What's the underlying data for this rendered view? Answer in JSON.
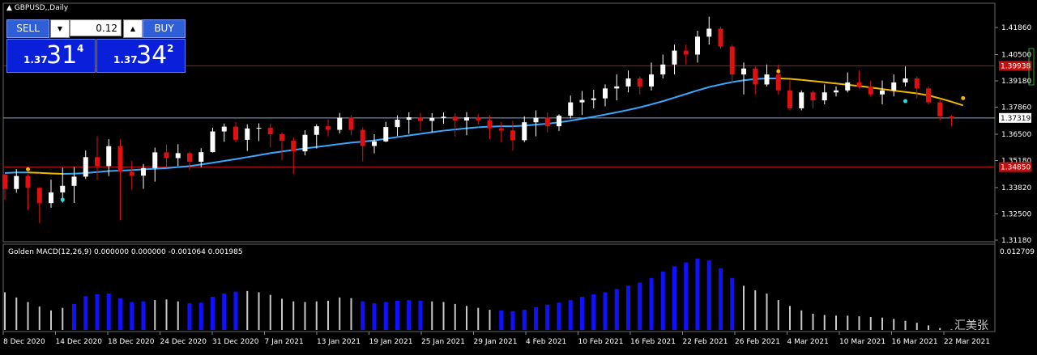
{
  "window": {
    "title": "▲ GBPUSD,,Daily"
  },
  "trade_panel": {
    "sell_label": "SELL",
    "buy_label": "BUY",
    "lot_value": "0.12",
    "down_arrow": "▼",
    "up_arrow": "▲",
    "bid": {
      "prefix": "1.37",
      "big": "31",
      "sup": "4"
    },
    "ask": {
      "prefix": "1.37",
      "big": "34",
      "sup": "2"
    }
  },
  "price_axis": {
    "ticks": [
      "1.41860",
      "1.40500",
      "1.39180",
      "1.37860",
      "1.36500",
      "1.35180",
      "1.33820",
      "1.32500",
      "1.31180"
    ],
    "labels": [
      {
        "text": "1.39938",
        "value": 1.39938,
        "color": "#d01010"
      },
      {
        "text": "1.37319",
        "value": 1.37319,
        "color": "#ffffff"
      },
      {
        "text": "1.34850",
        "value": 1.3485,
        "color": "#d01010"
      }
    ]
  },
  "indicator": {
    "label": "Golden MACD(12,26,9) 0.000000 0.000000 -0.001064 0.001985",
    "max_label": "0.012709"
  },
  "date_axis": [
    "8 Dec 2020",
    "14 Dec 2020",
    "18 Dec 2020",
    "24 Dec 2020",
    "31 Dec 2020",
    "7 Jan 2021",
    "13 Jan 2021",
    "19 Jan 2021",
    "25 Jan 2021",
    "29 Jan 2021",
    "4 Feb 2021",
    "10 Feb 2021",
    "16 Feb 2021",
    "22 Feb 2021",
    "26 Feb 2021",
    "4 Mar 2021",
    "10 Mar 2021",
    "16 Mar 2021",
    "22 Mar 2021"
  ],
  "watermark": "汇美张",
  "colors": {
    "bull": "#ffffff",
    "bear": "#e01010",
    "ma_up": "#39a8ff",
    "ma_down": "#f0b800",
    "macd_pos": "#1010ff",
    "macd_other": "#c8c8c8",
    "hline": "#c01010",
    "cur_line": "#7fa9d8"
  },
  "chart_data": {
    "type": "candlestick",
    "symbol": "GBPUSD",
    "timeframe": "Daily",
    "ylim": [
      1.3118,
      1.4186
    ],
    "candles": [
      [
        1.3448,
        1.345,
        1.332,
        1.3375
      ],
      [
        1.3375,
        1.3475,
        1.3356,
        1.344
      ],
      [
        1.344,
        1.345,
        1.327,
        1.3381
      ],
      [
        1.3381,
        1.3384,
        1.3204,
        1.3304
      ],
      [
        1.3304,
        1.3422,
        1.3281,
        1.3358
      ],
      [
        1.3358,
        1.3482,
        1.3307,
        1.3391
      ],
      [
        1.3391,
        1.3486,
        1.3305,
        1.3437
      ],
      [
        1.3437,
        1.3568,
        1.3425,
        1.3535
      ],
      [
        1.3535,
        1.364,
        1.342,
        1.349
      ],
      [
        1.349,
        1.3625,
        1.344,
        1.359
      ],
      [
        1.359,
        1.3624,
        1.3218,
        1.3461
      ],
      [
        1.3461,
        1.3517,
        1.3372,
        1.3442
      ],
      [
        1.3442,
        1.35,
        1.3376,
        1.348
      ],
      [
        1.348,
        1.3583,
        1.3412,
        1.3559
      ],
      [
        1.3559,
        1.3598,
        1.3482,
        1.353
      ],
      [
        1.353,
        1.36,
        1.349,
        1.3555
      ],
      [
        1.3555,
        1.3563,
        1.347,
        1.3512
      ],
      [
        1.3512,
        1.358,
        1.3484,
        1.356
      ],
      [
        1.356,
        1.3683,
        1.3558,
        1.3664
      ],
      [
        1.3664,
        1.3704,
        1.3612,
        1.3688
      ],
      [
        1.3688,
        1.3711,
        1.3609,
        1.3622
      ],
      [
        1.3622,
        1.37,
        1.3566,
        1.3679
      ],
      [
        1.3679,
        1.3705,
        1.3616,
        1.3682
      ],
      [
        1.3682,
        1.3703,
        1.3584,
        1.365
      ],
      [
        1.365,
        1.366,
        1.352,
        1.3617
      ],
      [
        1.3617,
        1.3635,
        1.345,
        1.3564
      ],
      [
        1.3564,
        1.367,
        1.3544,
        1.3647
      ],
      [
        1.3647,
        1.37,
        1.3578,
        1.369
      ],
      [
        1.369,
        1.3725,
        1.364,
        1.3672
      ],
      [
        1.3672,
        1.3757,
        1.3654,
        1.3733
      ],
      [
        1.3733,
        1.3745,
        1.3646,
        1.3672
      ],
      [
        1.3672,
        1.3685,
        1.3514,
        1.3591
      ],
      [
        1.3591,
        1.365,
        1.3554,
        1.3614
      ],
      [
        1.3614,
        1.3712,
        1.361,
        1.3686
      ],
      [
        1.3686,
        1.3745,
        1.3641,
        1.3723
      ],
      [
        1.3723,
        1.376,
        1.3652,
        1.3735
      ],
      [
        1.3735,
        1.3757,
        1.3665,
        1.3717
      ],
      [
        1.3717,
        1.3756,
        1.3659,
        1.3732
      ],
      [
        1.3732,
        1.3759,
        1.3702,
        1.3738
      ],
      [
        1.3738,
        1.3755,
        1.3639,
        1.3719
      ],
      [
        1.3719,
        1.3761,
        1.3645,
        1.3735
      ],
      [
        1.3735,
        1.3752,
        1.3699,
        1.372
      ],
      [
        1.372,
        1.3745,
        1.3625,
        1.368
      ],
      [
        1.368,
        1.3711,
        1.361,
        1.3669
      ],
      [
        1.3669,
        1.3717,
        1.3567,
        1.362
      ],
      [
        1.362,
        1.374,
        1.361,
        1.371
      ],
      [
        1.371,
        1.377,
        1.364,
        1.3733
      ],
      [
        1.3733,
        1.376,
        1.3659,
        1.369
      ],
      [
        1.369,
        1.375,
        1.3667,
        1.3743
      ],
      [
        1.3743,
        1.3844,
        1.3729,
        1.381
      ],
      [
        1.381,
        1.3867,
        1.3747,
        1.3822
      ],
      [
        1.3822,
        1.3873,
        1.378,
        1.383
      ],
      [
        1.383,
        1.39,
        1.379,
        1.388
      ],
      [
        1.388,
        1.395,
        1.382,
        1.389
      ],
      [
        1.389,
        1.397,
        1.386,
        1.393
      ],
      [
        1.393,
        1.394,
        1.385,
        1.389
      ],
      [
        1.389,
        1.401,
        1.387,
        1.395
      ],
      [
        1.395,
        1.405,
        1.393,
        1.4
      ],
      [
        1.4,
        1.41,
        1.395,
        1.407
      ],
      [
        1.407,
        1.41,
        1.4,
        1.405
      ],
      [
        1.405,
        1.417,
        1.401,
        1.414
      ],
      [
        1.414,
        1.424,
        1.41,
        1.418
      ],
      [
        1.418,
        1.419,
        1.408,
        1.409
      ],
      [
        1.409,
        1.41,
        1.391,
        1.395
      ],
      [
        1.395,
        1.401,
        1.385,
        1.398
      ],
      [
        1.398,
        1.399,
        1.385,
        1.39
      ],
      [
        1.39,
        1.4,
        1.389,
        1.395
      ],
      [
        1.395,
        1.4,
        1.385,
        1.387
      ],
      [
        1.387,
        1.392,
        1.377,
        1.378
      ],
      [
        1.378,
        1.387,
        1.377,
        1.386
      ],
      [
        1.386,
        1.387,
        1.378,
        1.382
      ],
      [
        1.382,
        1.39,
        1.38,
        1.386
      ],
      [
        1.386,
        1.389,
        1.384,
        1.387
      ],
      [
        1.387,
        1.396,
        1.386,
        1.391
      ],
      [
        1.391,
        1.397,
        1.388,
        1.389
      ],
      [
        1.389,
        1.392,
        1.384,
        1.385
      ],
      [
        1.385,
        1.392,
        1.38,
        1.387
      ],
      [
        1.387,
        1.395,
        1.384,
        1.391
      ],
      [
        1.391,
        1.399,
        1.389,
        1.393
      ],
      [
        1.393,
        1.394,
        1.383,
        1.388
      ],
      [
        1.388,
        1.389,
        1.38,
        1.381
      ],
      [
        1.381,
        1.382,
        1.372,
        1.374
      ],
      [
        1.374,
        1.3745,
        1.369,
        1.3731
      ]
    ],
    "moving_average": [
      1.3455,
      1.3458,
      1.3458,
      1.3456,
      1.3453,
      1.3451,
      1.3452,
      1.3455,
      1.346,
      1.3465,
      1.3467,
      1.347,
      1.3474,
      1.3477,
      1.348,
      1.3485,
      1.349,
      1.3498,
      1.3507,
      1.3516,
      1.3525,
      1.3535,
      1.3545,
      1.3555,
      1.3563,
      1.3571,
      1.3579,
      1.3586,
      1.3593,
      1.3601,
      1.3608,
      1.3613,
      1.3619,
      1.3627,
      1.3636,
      1.3644,
      1.3652,
      1.366,
      1.3668,
      1.3674,
      1.368,
      1.3685,
      1.3688,
      1.369,
      1.369,
      1.3693,
      1.3698,
      1.3703,
      1.371,
      1.3718,
      1.3728,
      1.3738,
      1.3749,
      1.376,
      1.3772,
      1.3785,
      1.38,
      1.3816,
      1.3834,
      1.3852,
      1.387,
      1.3887,
      1.39,
      1.3912,
      1.3921,
      1.3927,
      1.393,
      1.393,
      1.3928,
      1.3923,
      1.3917,
      1.3911,
      1.3905,
      1.3898,
      1.3892,
      1.3885,
      1.3877,
      1.3869,
      1.3862,
      1.3855,
      1.3845,
      1.383,
      1.3813,
      1.3795
    ],
    "macd_histogram": [
      0.0058,
      0.005,
      0.0043,
      0.0036,
      0.003,
      0.0034,
      0.004,
      0.0052,
      0.0055,
      0.0056,
      0.0049,
      0.0043,
      0.0044,
      0.0046,
      0.0047,
      0.0044,
      0.0041,
      0.0042,
      0.0051,
      0.0056,
      0.0059,
      0.006,
      0.0058,
      0.0054,
      0.0048,
      0.0044,
      0.0043,
      0.0044,
      0.0045,
      0.005,
      0.0049,
      0.0044,
      0.0041,
      0.0043,
      0.0045,
      0.0046,
      0.0045,
      0.0044,
      0.0043,
      0.004,
      0.0037,
      0.0034,
      0.0031,
      0.003,
      0.0029,
      0.0031,
      0.0035,
      0.0039,
      0.0042,
      0.0046,
      0.0051,
      0.0055,
      0.0058,
      0.0063,
      0.0068,
      0.0073,
      0.008,
      0.009,
      0.0098,
      0.0104,
      0.011,
      0.0107,
      0.0095,
      0.008,
      0.0068,
      0.0061,
      0.0056,
      0.0046,
      0.0037,
      0.003,
      0.0025,
      0.0023,
      0.0022,
      0.0022,
      0.0021,
      0.002,
      0.0019,
      0.0017,
      0.0014,
      0.0011,
      0.0007,
      0.0003,
      0.0001,
      0.0
    ],
    "macd_blue_from": [
      6,
      7,
      8,
      9,
      10,
      11,
      12,
      16,
      17,
      18,
      19,
      20,
      31,
      32,
      33,
      34,
      35,
      36,
      43,
      44,
      45,
      46,
      47,
      48,
      49,
      50,
      51,
      52,
      53,
      54,
      55,
      56,
      57,
      58,
      59,
      60,
      61,
      62,
      63
    ]
  }
}
